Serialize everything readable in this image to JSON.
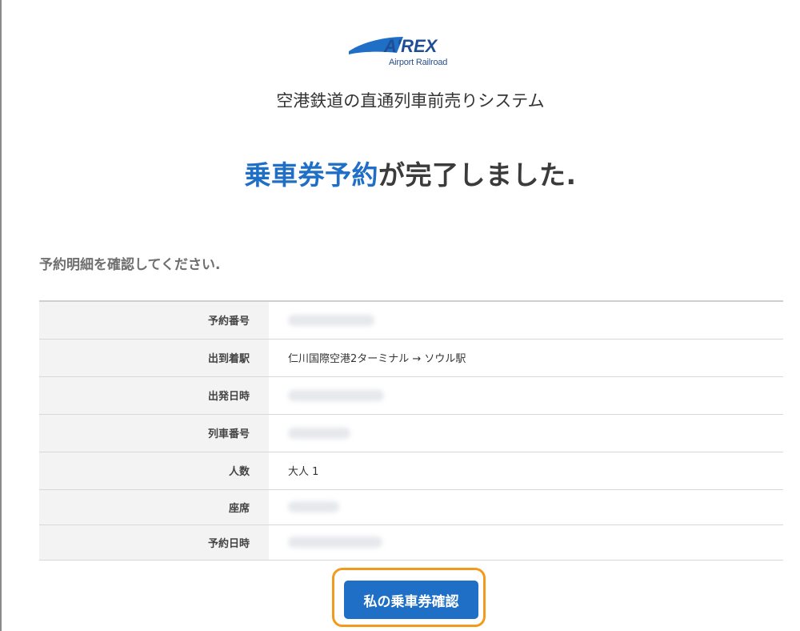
{
  "header": {
    "logo_text": "A'REX",
    "logo_sub": "Airport Railroad",
    "system_title": "空港鉄道の直通列車前売りシステム"
  },
  "completion": {
    "highlight": "乗車券予約",
    "rest": "が完了しました."
  },
  "instruction": "予約明細を確認してください.",
  "details": [
    {
      "label": "予約番号",
      "value": ""
    },
    {
      "label": "出到着駅",
      "value": "仁川国際空港2ターミナル → ソウル駅"
    },
    {
      "label": "出発日時",
      "value": ""
    },
    {
      "label": "列車番号",
      "value": ""
    },
    {
      "label": "人数",
      "value": "大人 1"
    },
    {
      "label": "座席",
      "value": ""
    },
    {
      "label": "予約日時",
      "value": ""
    }
  ],
  "button": {
    "label": "私の乗車券確認"
  },
  "colors": {
    "accent": "#1f6fc6",
    "highlight_border": "#f29a1b",
    "label_bg": "#f3f3f3"
  }
}
